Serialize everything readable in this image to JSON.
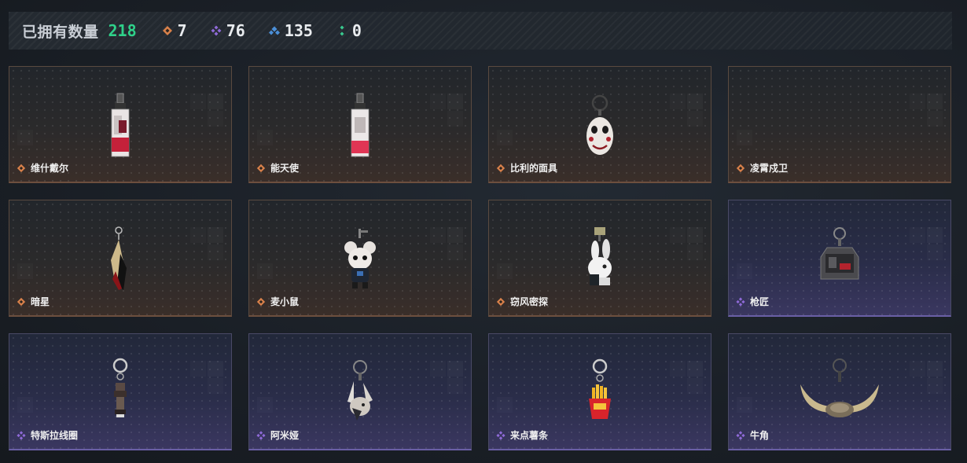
{
  "header": {
    "owned_label": "已拥有数量",
    "owned_count": "218",
    "stats": [
      {
        "icon": "orange-diamond-icon",
        "color": "#d9814a",
        "value": "7"
      },
      {
        "icon": "purple-diamond-icon",
        "color": "#8f6ad8",
        "value": "76"
      },
      {
        "icon": "blue-diamond-icon",
        "color": "#4b8fd8",
        "value": "135"
      },
      {
        "icon": "green-diamond-icon",
        "color": "#39c98f",
        "value": "0"
      }
    ]
  },
  "colors": {
    "owned_count": "#2fd28a",
    "rarity_orange": "#d9814a",
    "rarity_purple": "#8f6ad8"
  },
  "items": [
    {
      "name": "维什戴尔",
      "rarity": "orange",
      "art": "tag-keychain-icon"
    },
    {
      "name": "能天使",
      "rarity": "orange",
      "art": "tag-keychain-icon"
    },
    {
      "name": "比利的面具",
      "rarity": "orange",
      "art": "mask-keychain-icon"
    },
    {
      "name": "凌霄戍卫",
      "rarity": "orange",
      "art": "empty"
    },
    {
      "name": "暗星",
      "rarity": "orange",
      "art": "blade-keychain-icon"
    },
    {
      "name": "麦小鼠",
      "rarity": "orange",
      "art": "mouse-keychain-icon"
    },
    {
      "name": "窃风密探",
      "rarity": "orange",
      "art": "rabbit-keychain-icon"
    },
    {
      "name": "枪匠",
      "rarity": "purple",
      "art": "cabinet-keychain-icon"
    },
    {
      "name": "特斯拉线圈",
      "rarity": "purple",
      "art": "coil-keychain-icon"
    },
    {
      "name": "阿米娅",
      "rarity": "purple",
      "art": "bunny-keychain-icon"
    },
    {
      "name": "来点薯条",
      "rarity": "purple",
      "art": "fries-keychain-icon"
    },
    {
      "name": "牛角",
      "rarity": "purple",
      "art": "horns-keychain-icon"
    }
  ]
}
